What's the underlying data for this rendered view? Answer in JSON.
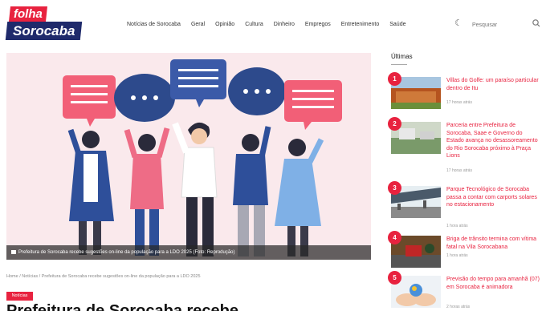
{
  "logo": {
    "line1": "folha",
    "line2": "Sorocaba"
  },
  "nav": {
    "items": [
      "Notícias de Sorocaba",
      "Geral",
      "Opinião",
      "Cultura",
      "Dinheiro",
      "Empregos",
      "Entretenimento",
      "Saúde"
    ],
    "search_placeholder": "Pesquisar"
  },
  "hero": {
    "caption": "Prefeitura de Sorocaba recebe sugestões on-line da população para a LDO 2025 (Foto: Reprodução)"
  },
  "article": {
    "breadcrumb": "Home / Notícias / Prefeitura de Sorocaba recebe sugestões on-line da população para a LDO 2025",
    "category": "Notícias",
    "headline": "Prefeitura de Sorocaba recebe"
  },
  "sidebar": {
    "title": "Últimas",
    "items": [
      {
        "num": "1",
        "title": "Villas do Golfe: um paraíso particular dentro de Itu",
        "time": "17 horas atrás"
      },
      {
        "num": "2",
        "title": "Parceria entre Prefeitura de Sorocaba, Saae e Governo do Estado avança no desassoreamento do Rio Sorocaba próximo à Praça Lions",
        "time": "17 horas atrás"
      },
      {
        "num": "3",
        "title": "Parque Tecnológico de Sorocaba passa a contar com carports solares no estacionamento",
        "time": "1 hora atrás"
      },
      {
        "num": "4",
        "title": "Briga de trânsito termina com vítima fatal na Vila Sorocabana",
        "time": "1 hora atrás"
      },
      {
        "num": "5",
        "title": "Previsão do tempo para amanhã (07) em Sorocaba é animadora",
        "time": "2 horas atrás"
      }
    ]
  },
  "colors": {
    "brand_red": "#e8223f",
    "brand_navy": "#1f2a6b"
  }
}
